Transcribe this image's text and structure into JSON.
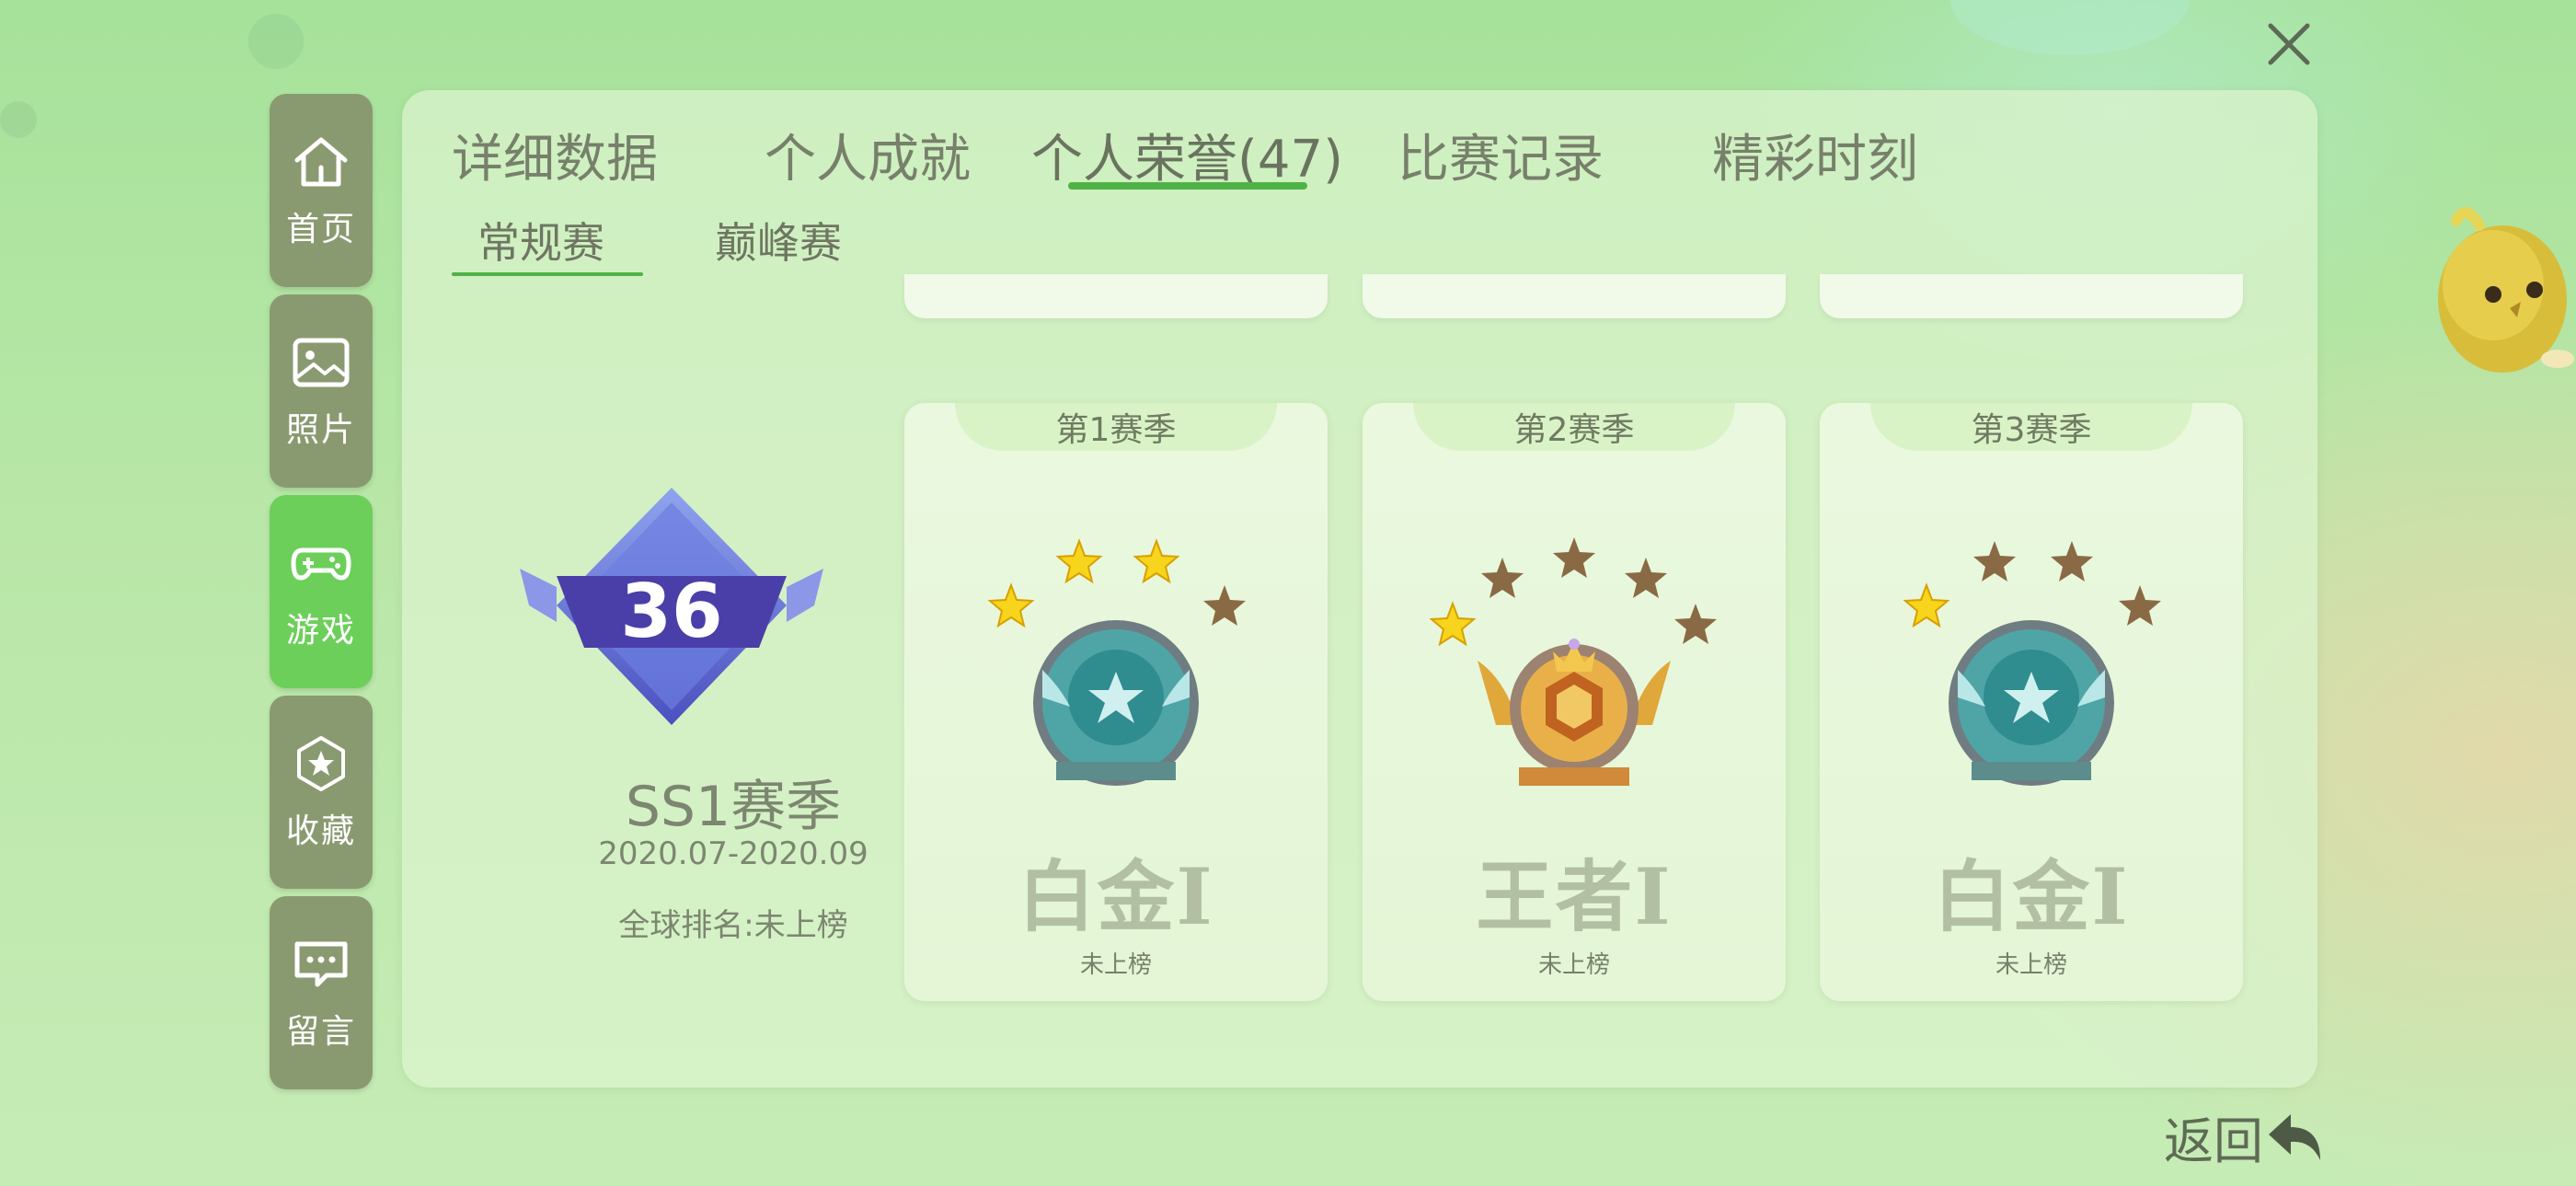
{
  "colors": {
    "accent": "#4fb246",
    "sidebar": "#8a9a70",
    "sidebar_active": "#6ccf5a"
  },
  "sidebar": {
    "items": [
      {
        "label": "首页",
        "icon": "home-icon",
        "active": false
      },
      {
        "label": "照片",
        "icon": "photo-icon",
        "active": false
      },
      {
        "label": "游戏",
        "icon": "gamepad-icon",
        "active": true
      },
      {
        "label": "收藏",
        "icon": "star-icon",
        "active": false
      },
      {
        "label": "留言",
        "icon": "message-icon",
        "active": false
      }
    ]
  },
  "tabs": [
    "详细数据",
    "个人成就",
    "个人荣誉(47)",
    "比赛记录",
    "精彩时刻"
  ],
  "active_tab": "个人荣誉(47)",
  "subtabs": [
    "常规赛",
    "巅峰赛"
  ],
  "active_subtab": "常规赛",
  "current_season": {
    "level": "36",
    "name": "SS1赛季",
    "dates": "2020.07-2020.09",
    "global_rank": "全球排名:未上榜"
  },
  "season_cards": [
    {
      "season": "第1赛季",
      "rank": "白金I",
      "rank_status": "未上榜",
      "stars_lit": 3,
      "stars_total": 4,
      "badge": "platinum"
    },
    {
      "season": "第2赛季",
      "rank": "王者I",
      "rank_status": "未上榜",
      "stars_lit": 1,
      "stars_total": 5,
      "badge": "king"
    },
    {
      "season": "第3赛季",
      "rank": "白金I",
      "rank_status": "未上榜",
      "stars_lit": 1,
      "stars_total": 4,
      "badge": "platinum"
    }
  ],
  "close_icon": "close-icon",
  "back_label": "返回",
  "back_icon": "back-arrow-icon"
}
